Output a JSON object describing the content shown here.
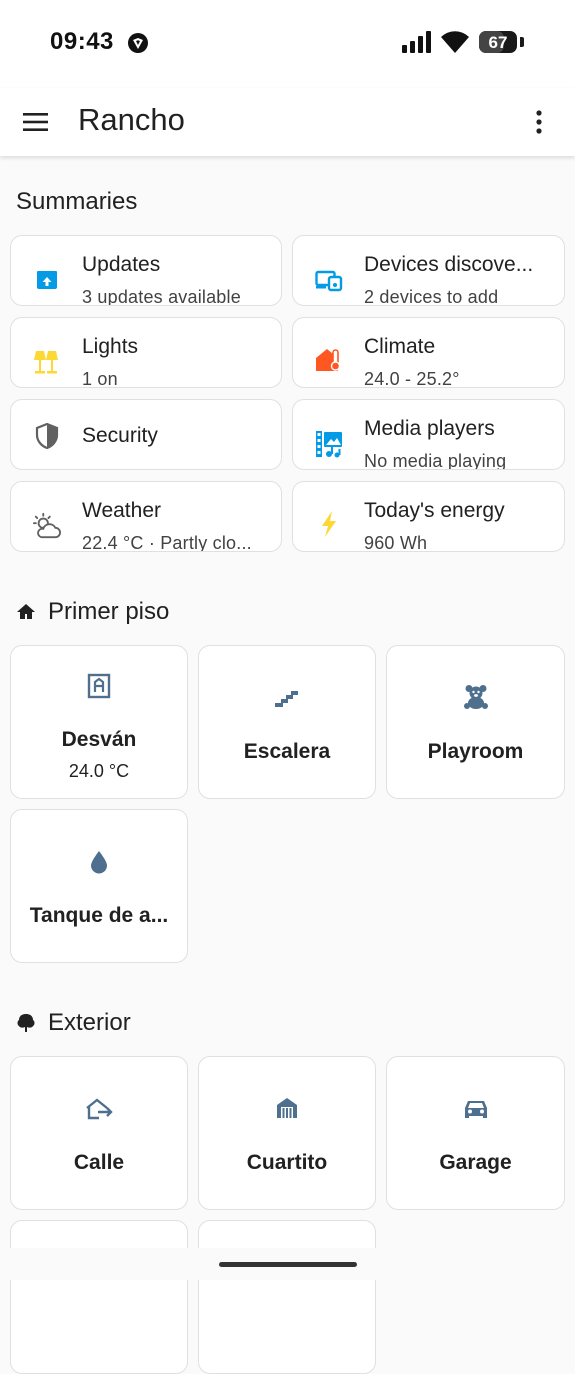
{
  "status_bar": {
    "time": "09:43",
    "battery": "67",
    "battery_fraction": 0.67
  },
  "app_bar": {
    "title": "Rancho",
    "menu_icon": "hamburger-menu-icon",
    "more_icon": "more-vertical-icon"
  },
  "summaries": {
    "title": "Summaries",
    "tiles": [
      {
        "name": "Updates",
        "state": "3 updates available",
        "icon": "package-up-icon",
        "color": "#039be5"
      },
      {
        "name": "Devices discove...",
        "state": "2 devices to add",
        "icon": "devices-icon",
        "color": "#039be5"
      },
      {
        "name": "Lights",
        "state": "1 on",
        "icon": "lamps-icon",
        "color": "#fdd835"
      },
      {
        "name": "Climate",
        "state": "24.0 - 25.2°",
        "icon": "home-thermometer-icon",
        "color": "#ff5722"
      },
      {
        "name": "Security",
        "state": "",
        "icon": "shield-half-icon",
        "color": "#616161"
      },
      {
        "name": "Media players",
        "state": "No media playing",
        "icon": "multimedia-icon",
        "color": "#039be5"
      },
      {
        "name": "Weather",
        "state": "22.4 °C · Partly clo...",
        "icon": "weather-partly-cloudy-icon",
        "color": "#616161"
      },
      {
        "name": "Today's energy",
        "state": "960 Wh",
        "icon": "lightning-bolt-icon",
        "color": "#fdd835"
      }
    ]
  },
  "primer_piso": {
    "title": "Primer piso",
    "icon": "home-roof-icon",
    "areas": [
      {
        "name": "Desván",
        "state": "24.0 °C",
        "icon": "attic-icon"
      },
      {
        "name": "Escalera",
        "state": "",
        "icon": "stairs-icon"
      },
      {
        "name": "Playroom",
        "state": "",
        "icon": "teddy-bear-icon"
      },
      {
        "name": "Tanque de a...",
        "state": "",
        "icon": "water-drop-icon"
      }
    ]
  },
  "exterior": {
    "title": "Exterior",
    "icon": "tree-icon",
    "areas": [
      {
        "name": "Calle",
        "state": "",
        "icon": "home-export-icon"
      },
      {
        "name": "Cuartito",
        "state": "",
        "icon": "shed-icon"
      },
      {
        "name": "Garage",
        "state": "",
        "icon": "car-icon"
      }
    ]
  },
  "colors": {
    "accent_area_icon": "#4f6f8f",
    "background": "#fafafa",
    "card": "#ffffff"
  }
}
